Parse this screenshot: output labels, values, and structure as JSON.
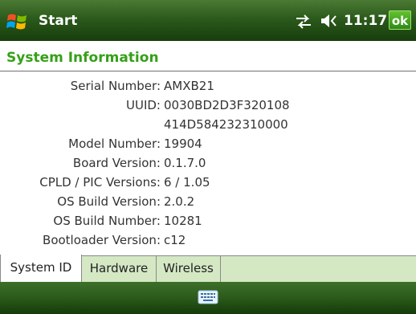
{
  "titlebar": {
    "start_label": "Start",
    "time": "11:17",
    "ok_label": "ok",
    "icons": [
      "windows-flag",
      "connectivity",
      "volume",
      "keyboard"
    ]
  },
  "page": {
    "title": "System Information"
  },
  "info": [
    {
      "label": "Serial Number:",
      "value": "AMXB21"
    },
    {
      "label": "UUID:",
      "value": "0030BD2D3F320108"
    },
    {
      "label": "",
      "value": "414D584232310000"
    },
    {
      "label": "Model Number:",
      "value": "19904"
    },
    {
      "label": "Board Version:",
      "value": "0.1.7.0"
    },
    {
      "label": "CPLD / PIC Versions:",
      "value": "6 / 1.05"
    },
    {
      "label": "OS Build Version:",
      "value": "2.0.2"
    },
    {
      "label": "OS Build Number:",
      "value": "10281"
    },
    {
      "label": "Bootloader Version:",
      "value": "c12"
    }
  ],
  "tabs": [
    {
      "label": "System ID",
      "active": true
    },
    {
      "label": "Hardware",
      "active": false
    },
    {
      "label": "Wireless",
      "active": false
    }
  ],
  "colors": {
    "title_green": "#35a018",
    "bar_green": "#2c5a1c",
    "tab_bg": "#d4e8c4"
  }
}
